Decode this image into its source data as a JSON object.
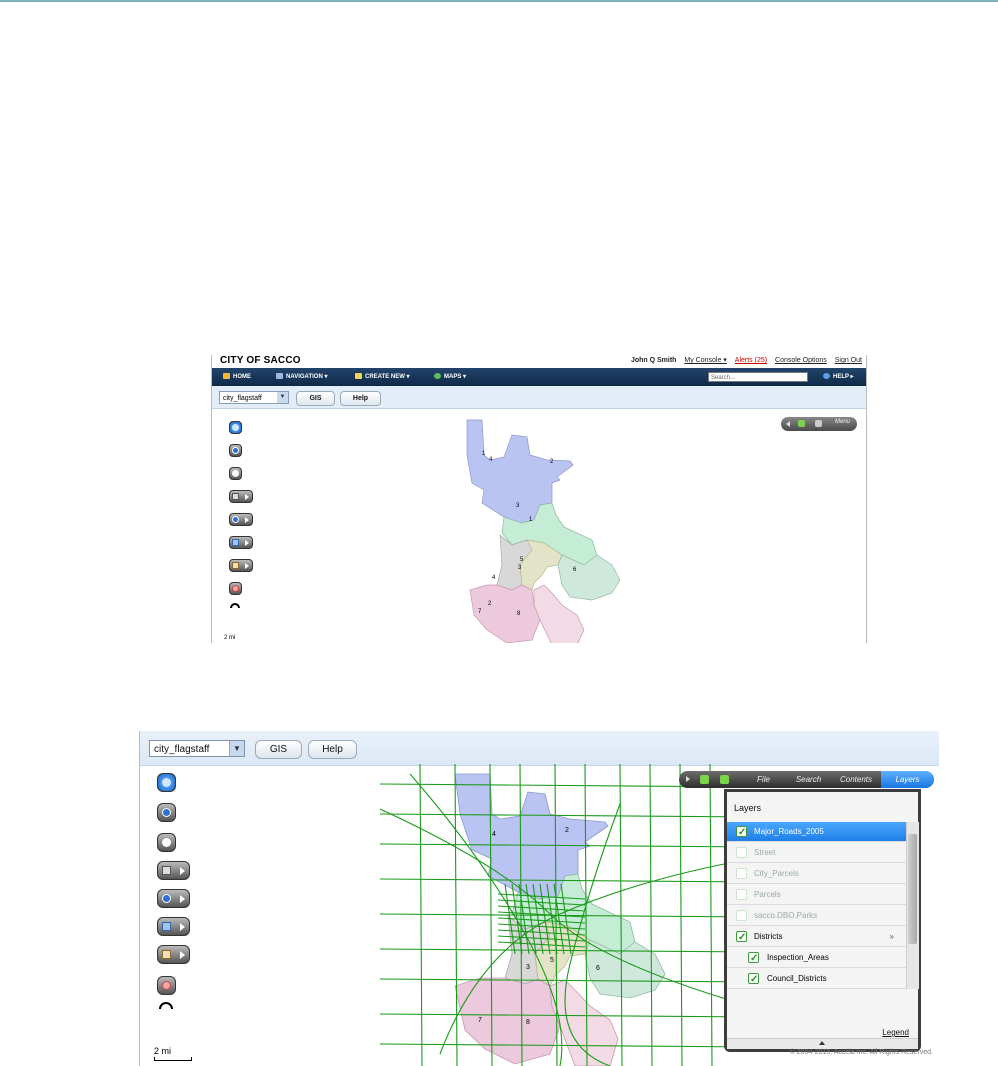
{
  "screenshot1": {
    "brand": "CITY OF SACCO",
    "user": {
      "name": "John Q Smith",
      "my_console": "My Console ▾",
      "alerts": "Alerts (25)",
      "console_options": "Console Options",
      "sign_out": "Sign Out"
    },
    "nav": {
      "home": "HOME",
      "navigation": "NAVIGATION ▾",
      "create_new": "CREATE NEW ▾",
      "maps": "MAPS ▾",
      "search_placeholder": "Search...",
      "help": "HELP ▸"
    },
    "toolbar": {
      "map_select": "city_flagstaff",
      "gis": "GIS",
      "help": "Help"
    },
    "map_control": {
      "menu": "Menu"
    },
    "scale": "2 mi",
    "district_labels": [
      "1",
      "4",
      "2",
      "3",
      "1",
      "5",
      "3",
      "6",
      "4",
      "2",
      "7",
      "8"
    ]
  },
  "screenshot2": {
    "toolbar": {
      "map_select": "city_flagstaff",
      "gis": "GIS",
      "help": "Help"
    },
    "tabs": [
      "File",
      "Search",
      "Contents",
      "Layers"
    ],
    "active_tab": "Layers",
    "panel": {
      "title": "Layers",
      "layers": [
        {
          "label": "Major_Roads_2005",
          "checked": true,
          "selected": true
        },
        {
          "label": "Street",
          "checked": false
        },
        {
          "label": "City_Parcels",
          "checked": false
        },
        {
          "label": "Parcels",
          "checked": false
        },
        {
          "label": "sacco.DBO.Parks",
          "checked": false
        },
        {
          "label": "Districts",
          "checked": true
        },
        {
          "label": "Inspection_Areas",
          "checked": true,
          "sub": true
        },
        {
          "label": "Council_Districts",
          "checked": true,
          "sub": true
        }
      ],
      "legend": "Legend"
    },
    "scale": "2 mi",
    "copyright": "© 2004-2013, Accela Inc. All Rights Reserved.",
    "district_labels": [
      "4",
      "2",
      "3",
      "5",
      "6",
      "7",
      "8"
    ]
  },
  "colors": {
    "nav_bg": "#0f2948",
    "toolbar_bg": "#e3edf8",
    "road_green": "#1a9a1a",
    "selected_layer": "#1f7fe8",
    "district_blue": "#b9c4f2",
    "district_green": "#c5ecd5",
    "district_pink": "#ecc9dc",
    "district_grey": "#d8d8d8",
    "district_tan": "#e3e3c8",
    "district_teal": "#cfe8dc"
  }
}
